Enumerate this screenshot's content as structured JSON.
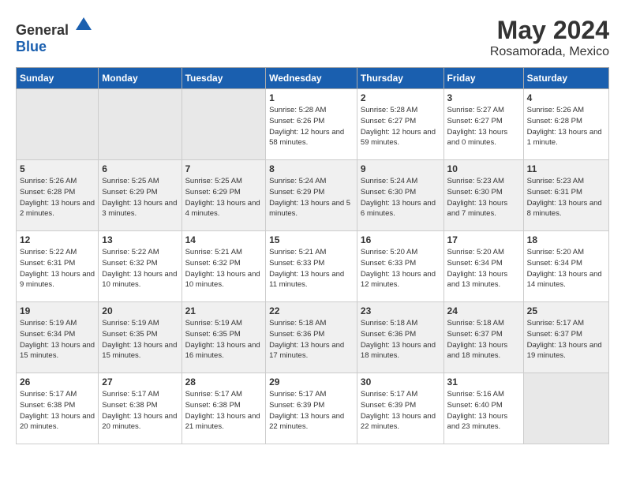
{
  "header": {
    "logo_general": "General",
    "logo_blue": "Blue",
    "title": "May 2024",
    "subtitle": "Rosamorada, Mexico"
  },
  "weekdays": [
    "Sunday",
    "Monday",
    "Tuesday",
    "Wednesday",
    "Thursday",
    "Friday",
    "Saturday"
  ],
  "weeks": [
    [
      {
        "day": "",
        "empty": true
      },
      {
        "day": "",
        "empty": true
      },
      {
        "day": "",
        "empty": true
      },
      {
        "day": "1",
        "sunrise": "5:28 AM",
        "sunset": "6:26 PM",
        "daylight": "12 hours and 58 minutes."
      },
      {
        "day": "2",
        "sunrise": "5:28 AM",
        "sunset": "6:27 PM",
        "daylight": "12 hours and 59 minutes."
      },
      {
        "day": "3",
        "sunrise": "5:27 AM",
        "sunset": "6:27 PM",
        "daylight": "13 hours and 0 minutes."
      },
      {
        "day": "4",
        "sunrise": "5:26 AM",
        "sunset": "6:28 PM",
        "daylight": "13 hours and 1 minute."
      }
    ],
    [
      {
        "day": "5",
        "sunrise": "5:26 AM",
        "sunset": "6:28 PM",
        "daylight": "13 hours and 2 minutes."
      },
      {
        "day": "6",
        "sunrise": "5:25 AM",
        "sunset": "6:29 PM",
        "daylight": "13 hours and 3 minutes."
      },
      {
        "day": "7",
        "sunrise": "5:25 AM",
        "sunset": "6:29 PM",
        "daylight": "13 hours and 4 minutes."
      },
      {
        "day": "8",
        "sunrise": "5:24 AM",
        "sunset": "6:29 PM",
        "daylight": "13 hours and 5 minutes."
      },
      {
        "day": "9",
        "sunrise": "5:24 AM",
        "sunset": "6:30 PM",
        "daylight": "13 hours and 6 minutes."
      },
      {
        "day": "10",
        "sunrise": "5:23 AM",
        "sunset": "6:30 PM",
        "daylight": "13 hours and 7 minutes."
      },
      {
        "day": "11",
        "sunrise": "5:23 AM",
        "sunset": "6:31 PM",
        "daylight": "13 hours and 8 minutes."
      }
    ],
    [
      {
        "day": "12",
        "sunrise": "5:22 AM",
        "sunset": "6:31 PM",
        "daylight": "13 hours and 9 minutes."
      },
      {
        "day": "13",
        "sunrise": "5:22 AM",
        "sunset": "6:32 PM",
        "daylight": "13 hours and 10 minutes."
      },
      {
        "day": "14",
        "sunrise": "5:21 AM",
        "sunset": "6:32 PM",
        "daylight": "13 hours and 10 minutes."
      },
      {
        "day": "15",
        "sunrise": "5:21 AM",
        "sunset": "6:33 PM",
        "daylight": "13 hours and 11 minutes."
      },
      {
        "day": "16",
        "sunrise": "5:20 AM",
        "sunset": "6:33 PM",
        "daylight": "13 hours and 12 minutes."
      },
      {
        "day": "17",
        "sunrise": "5:20 AM",
        "sunset": "6:34 PM",
        "daylight": "13 hours and 13 minutes."
      },
      {
        "day": "18",
        "sunrise": "5:20 AM",
        "sunset": "6:34 PM",
        "daylight": "13 hours and 14 minutes."
      }
    ],
    [
      {
        "day": "19",
        "sunrise": "5:19 AM",
        "sunset": "6:34 PM",
        "daylight": "13 hours and 15 minutes."
      },
      {
        "day": "20",
        "sunrise": "5:19 AM",
        "sunset": "6:35 PM",
        "daylight": "13 hours and 15 minutes."
      },
      {
        "day": "21",
        "sunrise": "5:19 AM",
        "sunset": "6:35 PM",
        "daylight": "13 hours and 16 minutes."
      },
      {
        "day": "22",
        "sunrise": "5:18 AM",
        "sunset": "6:36 PM",
        "daylight": "13 hours and 17 minutes."
      },
      {
        "day": "23",
        "sunrise": "5:18 AM",
        "sunset": "6:36 PM",
        "daylight": "13 hours and 18 minutes."
      },
      {
        "day": "24",
        "sunrise": "5:18 AM",
        "sunset": "6:37 PM",
        "daylight": "13 hours and 18 minutes."
      },
      {
        "day": "25",
        "sunrise": "5:17 AM",
        "sunset": "6:37 PM",
        "daylight": "13 hours and 19 minutes."
      }
    ],
    [
      {
        "day": "26",
        "sunrise": "5:17 AM",
        "sunset": "6:38 PM",
        "daylight": "13 hours and 20 minutes."
      },
      {
        "day": "27",
        "sunrise": "5:17 AM",
        "sunset": "6:38 PM",
        "daylight": "13 hours and 20 minutes."
      },
      {
        "day": "28",
        "sunrise": "5:17 AM",
        "sunset": "6:38 PM",
        "daylight": "13 hours and 21 minutes."
      },
      {
        "day": "29",
        "sunrise": "5:17 AM",
        "sunset": "6:39 PM",
        "daylight": "13 hours and 22 minutes."
      },
      {
        "day": "30",
        "sunrise": "5:17 AM",
        "sunset": "6:39 PM",
        "daylight": "13 hours and 22 minutes."
      },
      {
        "day": "31",
        "sunrise": "5:16 AM",
        "sunset": "6:40 PM",
        "daylight": "13 hours and 23 minutes."
      },
      {
        "day": "",
        "empty": true
      }
    ]
  ]
}
